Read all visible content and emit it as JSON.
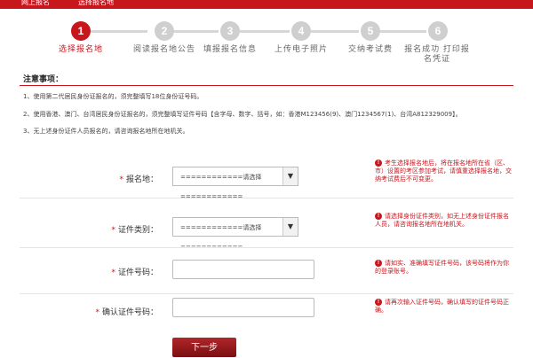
{
  "header": {
    "left_text": "网上报名",
    "right_text": "选择报名地"
  },
  "steps": [
    {
      "num": "1",
      "label": "选择报名地",
      "active": true
    },
    {
      "num": "2",
      "label": "阅读报名地公告",
      "active": false
    },
    {
      "num": "3",
      "label": "填报报名信息",
      "active": false
    },
    {
      "num": "4",
      "label": "上传电子照片",
      "active": false
    },
    {
      "num": "5",
      "label": "交纳考试费",
      "active": false
    },
    {
      "num": "6",
      "label": "报名成功 打印报名凭证",
      "active": false
    }
  ],
  "notice": {
    "title": "注意事项：",
    "items": [
      "1、使用第二代居民身份证报名的，须完整填写18位身份证号码。",
      "2、使用香港、澳门、台湾居民身份证报名的，须完整填写证件号码【含字母、数字、括号，如：香港M123456(9)、澳门1234567(1)、台湾A812329009】。",
      "3、无上述身份证件人员报名的，请咨询报名地所在地机关。"
    ]
  },
  "form": {
    "region": {
      "label": "报名地：",
      "value": "============请选择============",
      "hint": "考生选择报名地后，将在报名地所在省（区、市）设置的考区参加考试，请慎重选择报名地，交纳考试费后不可变更。"
    },
    "id_type": {
      "label": "证件类别：",
      "value": "============请选择============",
      "hint": "请选择身份证件类别，如无上述身份证件报名人员，请咨询报名地所在地机关。"
    },
    "id_number": {
      "label": "证件号码：",
      "value": "",
      "hint": "请如实、准确填写证件号码，该号码将作为你的登录账号。"
    },
    "id_confirm": {
      "label": "确认证件号码：",
      "value": "",
      "hint": "请再次输入证件号码，确认填写的证件号码正确。"
    },
    "required_mark": "*"
  },
  "buttons": {
    "next": "下一步"
  },
  "colors": {
    "accent": "#c8161d",
    "inactive_step": "#cfcfcf",
    "button_dark": "#7a0f12"
  }
}
